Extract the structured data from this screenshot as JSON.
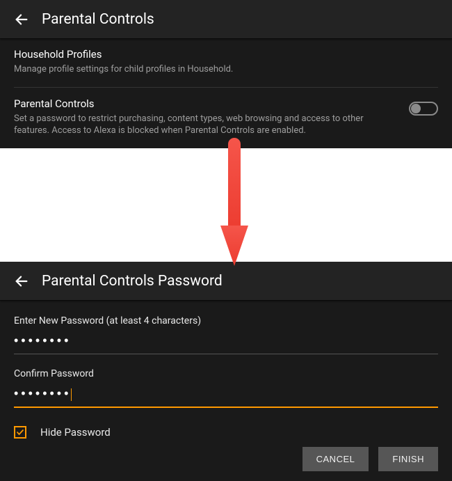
{
  "top": {
    "title": "Parental Controls",
    "household": {
      "title": "Household Profiles",
      "desc": "Manage profile settings for child profiles in Household."
    },
    "parental": {
      "title": "Parental Controls",
      "desc": "Set a password to restrict purchasing, content types, web browsing and access to other features. Access to Alexa is blocked when Parental Controls are enabled."
    }
  },
  "bottom": {
    "title": "Parental Controls Password",
    "field1_label": "Enter New Password (at least 4 characters)",
    "field1_value": "••••••••",
    "field2_label": "Confirm Password",
    "field2_value": "••••••••",
    "hide_label": "Hide Password",
    "cancel": "CANCEL",
    "finish": "FINISH"
  }
}
